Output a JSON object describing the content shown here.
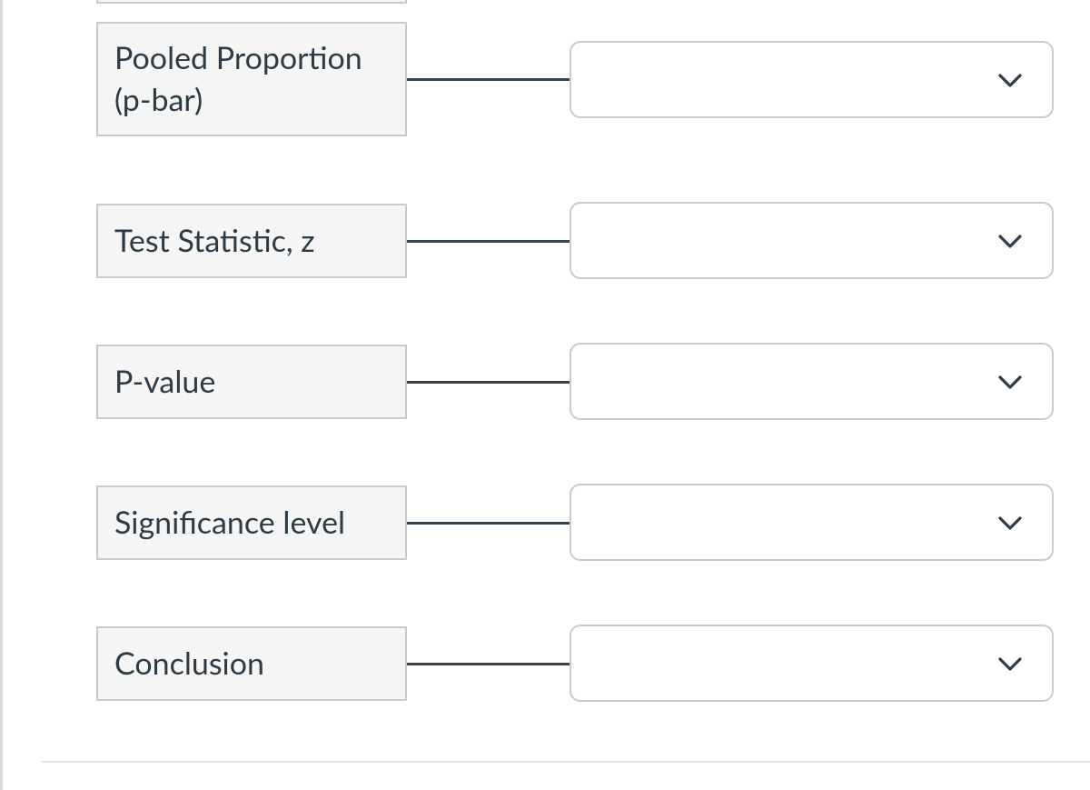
{
  "rows": [
    {
      "label": "Pooled Proportion\n(p-bar)",
      "value": ""
    },
    {
      "label": "Test Statistic, z",
      "value": ""
    },
    {
      "label": "P-value",
      "value": ""
    },
    {
      "label": "Significance level",
      "value": ""
    },
    {
      "label": "Conclusion",
      "value": ""
    }
  ]
}
